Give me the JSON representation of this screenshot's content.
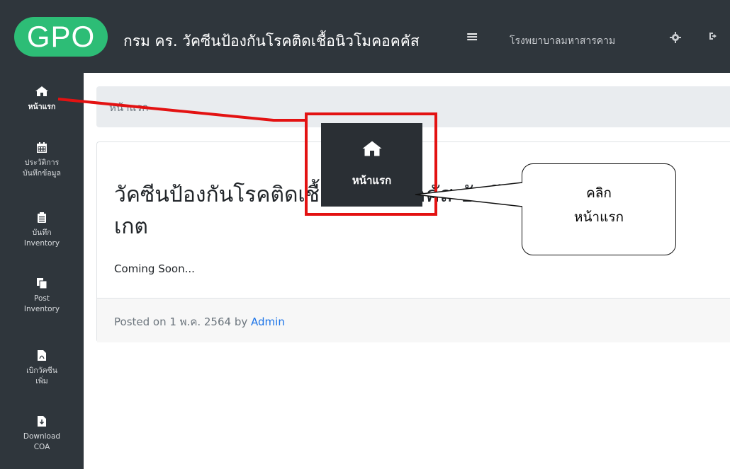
{
  "header": {
    "logo_text": "GPO",
    "title": "กรม คร. วัคซีนป้องกันโรคติดเชื้อนิวโมคอคคัส",
    "menu_icon": "≡",
    "hospital": "โรงพยาบาลมหาสารคาม"
  },
  "sidebar": {
    "items": [
      {
        "icon": "home-icon",
        "label": "หน้าแรก"
      },
      {
        "icon": "calendar-icon",
        "label_line1": "ประวัติการ",
        "label_line2": "บันทึกข้อมูล"
      },
      {
        "icon": "clipboard-icon",
        "label_line1": "บันทึก",
        "label_line2": "Inventory"
      },
      {
        "icon": "copy-icon",
        "label_line1": "Post",
        "label_line2": "Inventory"
      },
      {
        "icon": "pdf-file-icon",
        "label_line1": "เบิกวัคซีน",
        "label_line2": "เพิ่ม"
      },
      {
        "icon": "download-file-icon",
        "label_line1": "Download",
        "label_line2": "COA"
      }
    ]
  },
  "breadcrumb": "หน้าแรก",
  "post": {
    "title_line1": "วัคซีนป้องกันโรคติดเชื้อนิวโมคอคคัส บันทึกเหตุ",
    "title_line2": "เกต",
    "body": "Coming Soon...",
    "meta_prefix": "Posted on 1 พ.ค. 2564 by ",
    "author": "Admin"
  },
  "annotation": {
    "zoom_label": "หน้าแรก",
    "callout_line1": "คลิก",
    "callout_line2": "หน้าแรก"
  },
  "colors": {
    "header_bg": "#2f363c",
    "logo_green": "#2dbd76",
    "highlight_red": "#e31212",
    "link_blue": "#1a73e8"
  }
}
